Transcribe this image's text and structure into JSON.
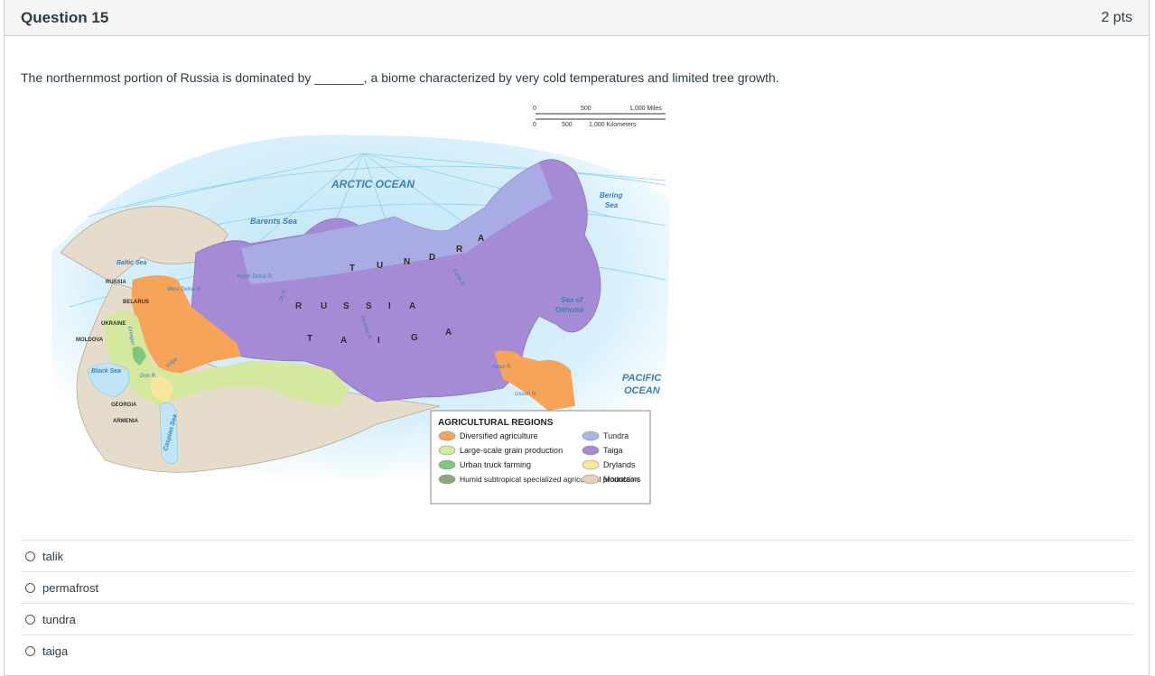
{
  "question": {
    "title": "Question 15",
    "points": "2 pts",
    "text": "The northernmost portion of Russia is dominated by _______, a biome characterized by very cold temperatures and limited tree growth."
  },
  "map": {
    "scale_miles": [
      "0",
      "500",
      "1,000 Miles"
    ],
    "scale_km": [
      "0",
      "500",
      "1,000 Kilometers"
    ],
    "labels": {
      "arctic": "ARCTIC OCEAN",
      "barents": "Barents Sea",
      "bering": "Bering",
      "bering2": "Sea",
      "okhotsk": "Sea of",
      "okhotsk2": "Okhotsk",
      "pacific": "PACIFIC",
      "pacific2": "OCEAN",
      "baltic": "Baltic Sea",
      "black": "Black Sea",
      "caspian": "Caspian Sea",
      "tundra_letters": [
        "T",
        "U",
        "N",
        "D",
        "R",
        "A"
      ],
      "russia_letters": [
        "R",
        "U",
        "S",
        "S",
        "I",
        "A"
      ],
      "taiga_letters": [
        "T",
        "A",
        "I",
        "G",
        "A"
      ],
      "russia_small": "RUSSIA",
      "belarus": "BELARUS",
      "ukraine": "UKRAINE",
      "moldova": "MOLDOVA",
      "georgia": "GEORGIA",
      "armenia": "ARMENIA",
      "west_dvina": "West Dvina R.",
      "north_dvina": "North Dvina R.",
      "ob": "Ob R.",
      "yenisey": "Yenisey R.",
      "lena": "Lena R.",
      "amur": "Amur R.",
      "ussuri": "Ussuri R.",
      "don": "Don R.",
      "volga": "Volga",
      "dnieper": "Dnieper"
    },
    "legend": {
      "title": "AGRICULTURAL REGIONS",
      "items": [
        {
          "label": "Diversified agriculture",
          "color": "#f5a45a"
        },
        {
          "label": "Large-scale grain production",
          "color": "#d4e8a0"
        },
        {
          "label": "Urban truck farming",
          "color": "#7fc77a"
        },
        {
          "label": "Humid subtropical specialized agricultural production",
          "color": "#8aa87a"
        },
        {
          "label": "Tundra",
          "color": "#a9b6e8"
        },
        {
          "label": "Taiga",
          "color": "#a58ad6"
        },
        {
          "label": "Drylands",
          "color": "#f8e79a"
        },
        {
          "label": "Mountains",
          "color": "#e0d2b8"
        }
      ]
    }
  },
  "answers": [
    {
      "label": "talik"
    },
    {
      "label": "permafrost"
    },
    {
      "label": "tundra"
    },
    {
      "label": "taiga"
    }
  ]
}
